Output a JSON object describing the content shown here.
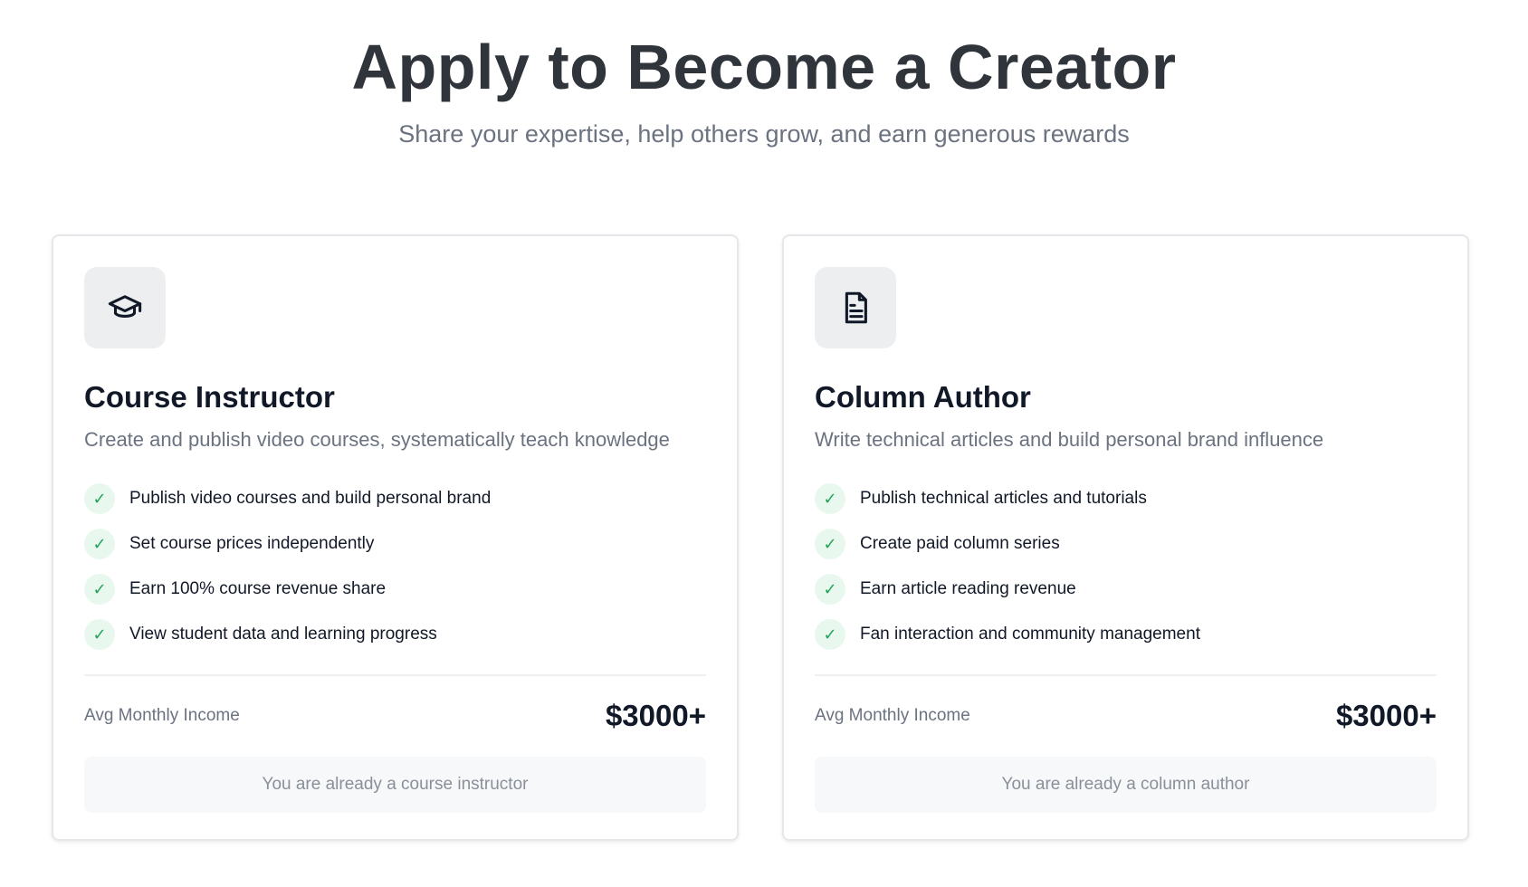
{
  "header": {
    "title": "Apply to Become a Creator",
    "subtitle": "Share your expertise, help others grow, and earn generous rewards"
  },
  "colors": {
    "text_primary": "#111827",
    "text_muted": "#6b7280",
    "title": "#30343b",
    "check_green": "#23a35a",
    "check_bg": "#e9f8ee",
    "icon_bg": "#eceef0",
    "disabled_button_bg": "#f7f8f9"
  },
  "cards": [
    {
      "icon": "graduation-cap-icon",
      "title": "Course Instructor",
      "description": "Create and publish video courses, systematically teach knowledge",
      "features": [
        "Publish video courses and build personal brand",
        "Set course prices independently",
        "Earn 100% course revenue share",
        "View student data and learning progress"
      ],
      "income_label": "Avg Monthly Income",
      "income_value": "$3000+",
      "status_button": "You are already a course instructor"
    },
    {
      "icon": "document-icon",
      "title": "Column Author",
      "description": "Write technical articles and build personal brand influence",
      "features": [
        "Publish technical articles and tutorials",
        "Create paid column series",
        "Earn article reading revenue",
        "Fan interaction and community management"
      ],
      "income_label": "Avg Monthly Income",
      "income_value": "$3000+",
      "status_button": "You are already a column author"
    }
  ]
}
